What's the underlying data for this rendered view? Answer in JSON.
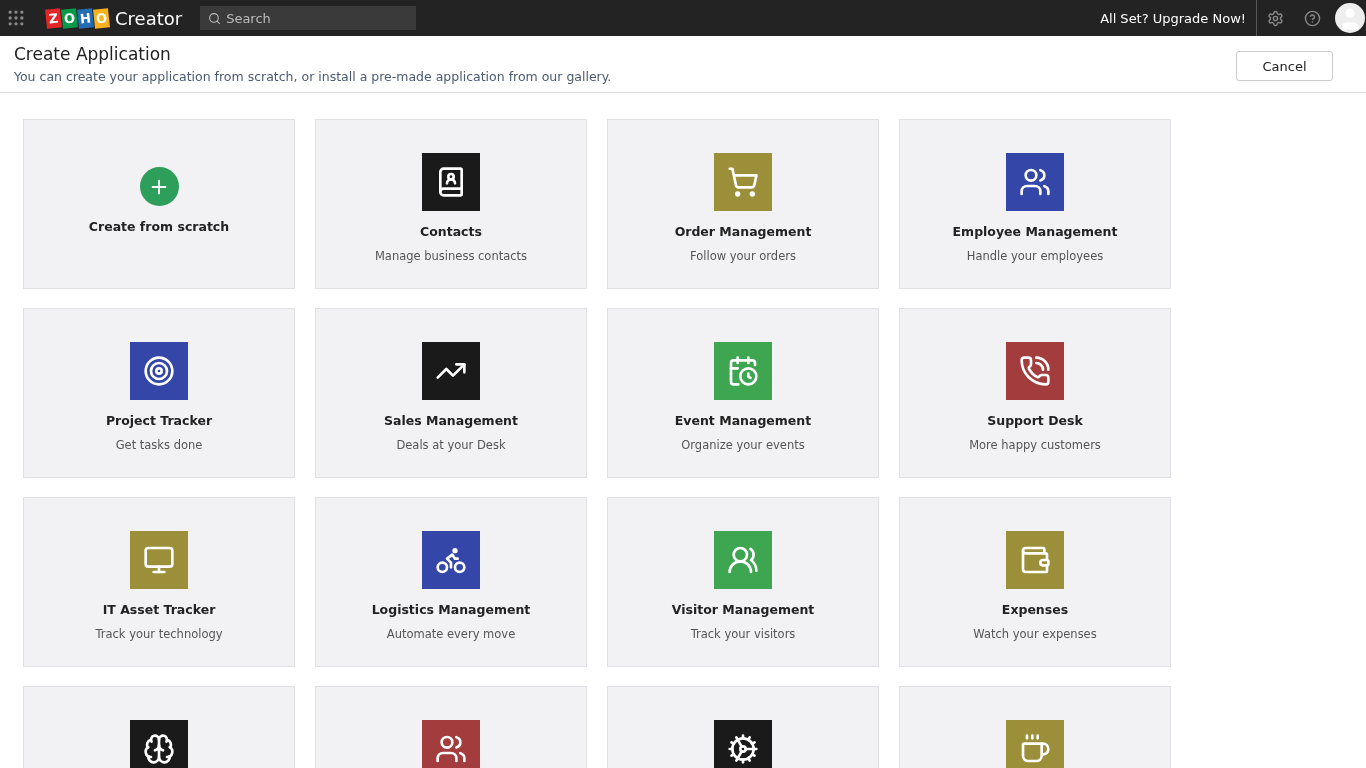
{
  "topbar": {
    "logo_letters": [
      {
        "char": "Z",
        "color": "#e42527"
      },
      {
        "char": "O",
        "color": "#089949"
      },
      {
        "char": "H",
        "color": "#226db4"
      },
      {
        "char": "O",
        "color": "#f9b21d"
      }
    ],
    "product": "Creator",
    "search": {
      "placeholder": "Search"
    },
    "upgrade": "All Set? Upgrade Now!"
  },
  "header": {
    "title": "Create Application",
    "subtitle": "You can create your application from scratch, or install a pre-made application from our gallery.",
    "cancel": "Cancel"
  },
  "cards": [
    {
      "kind": "create",
      "title": "Create from scratch",
      "color": "#2e9e5b"
    },
    {
      "kind": "template",
      "title": "Contacts",
      "subtitle": "Manage business contacts",
      "color": "#1a1a1a"
    },
    {
      "kind": "template",
      "title": "Order Management",
      "subtitle": "Follow your orders",
      "color": "#9c8f3a"
    },
    {
      "kind": "template",
      "title": "Employee Management",
      "subtitle": "Handle your employees",
      "color": "#3446a8"
    },
    {
      "kind": "template",
      "title": "Project Tracker",
      "subtitle": "Get tasks done",
      "color": "#3446a8"
    },
    {
      "kind": "template",
      "title": "Sales Management",
      "subtitle": "Deals at your Desk",
      "color": "#1a1a1a"
    },
    {
      "kind": "template",
      "title": "Event Management",
      "subtitle": "Organize your events",
      "color": "#3ea551"
    },
    {
      "kind": "template",
      "title": "Support Desk",
      "subtitle": "More happy customers",
      "color": "#a33c3c"
    },
    {
      "kind": "template",
      "title": "IT Asset Tracker",
      "subtitle": "Track your technology",
      "color": "#9c8f3a"
    },
    {
      "kind": "template",
      "title": "Logistics Management",
      "subtitle": "Automate every move",
      "color": "#3446a8"
    },
    {
      "kind": "template",
      "title": "Visitor Management",
      "subtitle": "Track your visitors",
      "color": "#3ea551"
    },
    {
      "kind": "template",
      "title": "Expenses",
      "subtitle": "Watch your expenses",
      "color": "#9c8f3a"
    },
    {
      "kind": "template",
      "color": "#1a1a1a"
    },
    {
      "kind": "template",
      "color": "#a33c3c"
    },
    {
      "kind": "template",
      "color": "#1a1a1a"
    },
    {
      "kind": "template",
      "color": "#9c8f3a"
    }
  ]
}
